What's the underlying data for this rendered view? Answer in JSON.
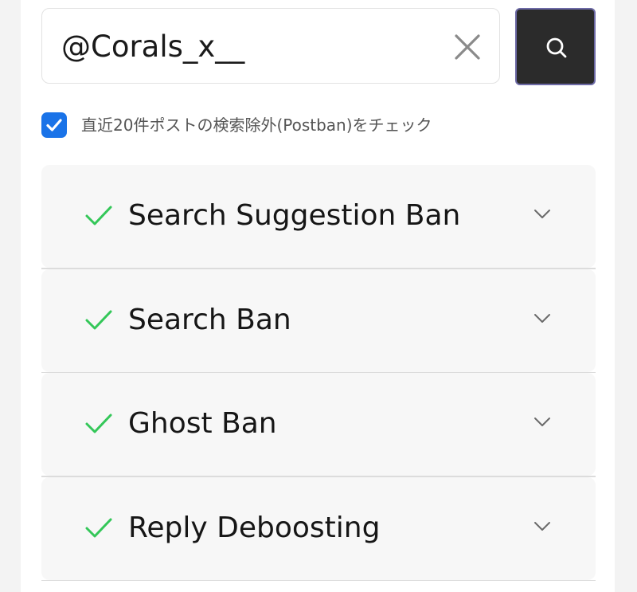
{
  "search": {
    "value": "@Corals_x__",
    "clear_icon": "close-icon",
    "submit_icon": "search-icon"
  },
  "postban_check": {
    "checked": true,
    "label": "直近20件ポストの検索除外(Postban)をチェック"
  },
  "results": [
    {
      "title": "Search Suggestion Ban",
      "status": "check-icon",
      "expand_icon": "chevron-down-icon"
    },
    {
      "title": "Search Ban",
      "status": "check-icon",
      "expand_icon": "chevron-down-icon"
    },
    {
      "title": "Ghost Ban",
      "status": "check-icon",
      "expand_icon": "chevron-down-icon"
    },
    {
      "title": "Reply Deboosting",
      "status": "check-icon",
      "expand_icon": "chevron-down-icon"
    }
  ],
  "colors": {
    "accent_blue": "#1a73e8",
    "success_green": "#34c759",
    "button_dark": "#2b2b2b"
  }
}
